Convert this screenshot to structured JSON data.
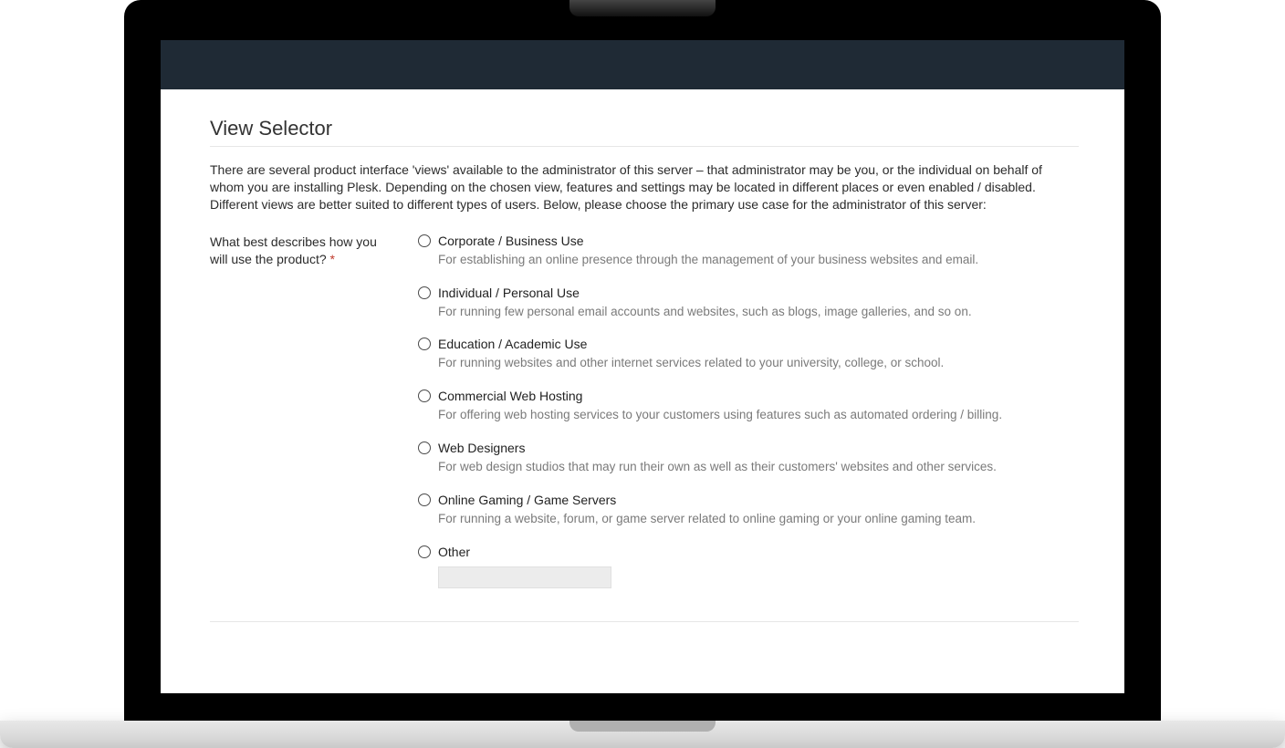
{
  "page": {
    "title": "View Selector",
    "intro": "There are several product interface 'views' available to the administrator of this server – that administrator may be you, or the individual on behalf of whom you are installing Plesk. Depending on the chosen view, features and settings may be located in different places or even enabled / disabled. Different views are better suited to different types of users. Below, please choose the primary use case for the administrator of this server:"
  },
  "form": {
    "question": "What best describes how you will use the product?",
    "required_mark": "*",
    "options": [
      {
        "label": "Corporate / Business Use",
        "description": "For establishing an online presence through the management of your business websites and email."
      },
      {
        "label": "Individual / Personal Use",
        "description": "For running few personal email accounts and websites, such as blogs, image galleries, and so on."
      },
      {
        "label": "Education / Academic Use",
        "description": "For running websites and other internet services related to your university, college, or school."
      },
      {
        "label": "Commercial Web Hosting",
        "description": "For offering web hosting services to your customers using features such as automated ordering / billing."
      },
      {
        "label": "Web Designers",
        "description": "For web design studios that may run their own as well as their customers' websites and other services."
      },
      {
        "label": "Online Gaming / Game Servers",
        "description": "For running a website, forum, or game server related to online gaming or your online gaming team."
      },
      {
        "label": "Other",
        "description": ""
      }
    ]
  }
}
